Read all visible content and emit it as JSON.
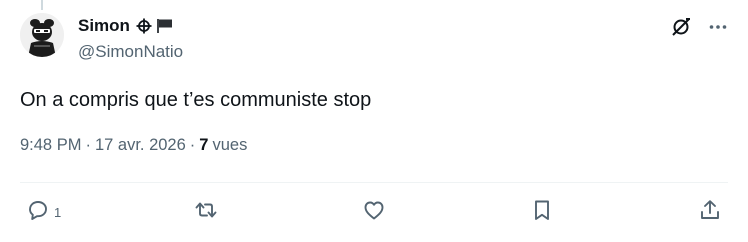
{
  "author": {
    "display_name": "Simon",
    "handle": "@SimonNatio"
  },
  "tweet": {
    "text": "On a compris que t’es communiste stop"
  },
  "meta": {
    "time": "9:48 PM",
    "separator": "·",
    "date": "17 avr. 2026",
    "views_count": "7",
    "views_label": "vues"
  },
  "actions": {
    "reply_count": "1"
  },
  "icons": {
    "verified_symbols": [
      "crosshair-icon",
      "flag-icon"
    ],
    "top": [
      "grok-icon",
      "more-icon"
    ],
    "actions": [
      "reply-icon",
      "retweet-icon",
      "like-icon",
      "bookmark-icon",
      "share-icon"
    ]
  },
  "colors": {
    "text_primary": "#0f1419",
    "text_secondary": "#536471",
    "divider": "#eff3f4"
  }
}
